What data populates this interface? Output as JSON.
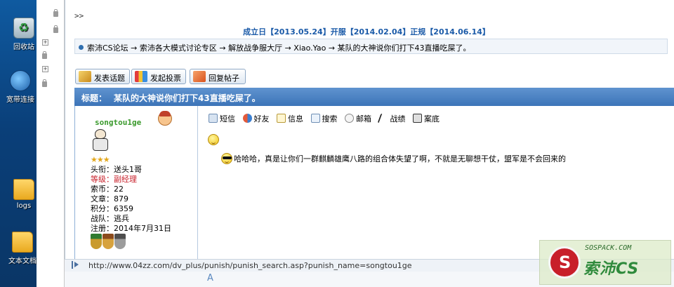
{
  "desktop": {
    "icons": [
      {
        "label": "回收站",
        "icon": "recycle-bin-icon"
      },
      {
        "label": "宽带连接",
        "icon": "network-icon"
      },
      {
        "label": "logs",
        "icon": "folder-icon"
      },
      {
        "label": "文本文档",
        "icon": "folder-icon"
      }
    ]
  },
  "page": {
    "chevron": ">>",
    "dates": "成立日【2013.05.24】开服【2014.02.04】正规【2014.06.14】",
    "breadcrumb": "索沛CS论坛 → 索沛各大模式讨论专区 → 解放战争服大厅 → Xiao.Yao → 某队的大神说你们打下43直播吃屎了。",
    "buttons": {
      "new_topic": "发表话题",
      "new_poll": "发起投票",
      "reply": "回复帖子"
    },
    "title_label": "标题：",
    "title": "某队的大神说你们打下43直播吃屎了。"
  },
  "user": {
    "name": "songtou1ge",
    "stars": "★★★",
    "info": [
      {
        "text": "头衔：送头1哥",
        "highlight": false
      },
      {
        "text": "等级：副经理",
        "highlight": true
      },
      {
        "text": "索币：22",
        "highlight": false
      },
      {
        "text": "文章：879",
        "highlight": false
      },
      {
        "text": "积分：6359",
        "highlight": false
      },
      {
        "text": "战队：逃兵",
        "highlight": false
      },
      {
        "text": "注册：2014年7月31日",
        "highlight": false
      }
    ]
  },
  "actions": [
    {
      "label": "短信",
      "icon": "message-icon"
    },
    {
      "label": "好友",
      "icon": "friends-icon"
    },
    {
      "label": "信息",
      "icon": "info-icon"
    },
    {
      "label": "搜索",
      "icon": "search-icon"
    },
    {
      "label": "邮箱",
      "icon": "mail-icon"
    },
    {
      "label": "战绩",
      "icon": "record-icon"
    },
    {
      "label": "案底",
      "icon": "case-record-icon"
    }
  ],
  "post": {
    "message": "哈哈哈，真是让你们一群麒麟雄鹰八路的组合体失望了啊，不就是无聊想干仗，盟军是不会回来的"
  },
  "status": {
    "url": "http://www.04zz.com/dv_plus/punish/punish_search.asp?punish_name=songtou1ge"
  },
  "below": {
    "text": "A"
  },
  "watermark": {
    "url": "SOSPACK.COM",
    "brand": "索沛CS"
  },
  "colors": {
    "title_bar": "#3c74b8",
    "dates_blue": "#1a5aa8",
    "username_green": "#3a9a2c",
    "rank_red": "#c8202a"
  }
}
